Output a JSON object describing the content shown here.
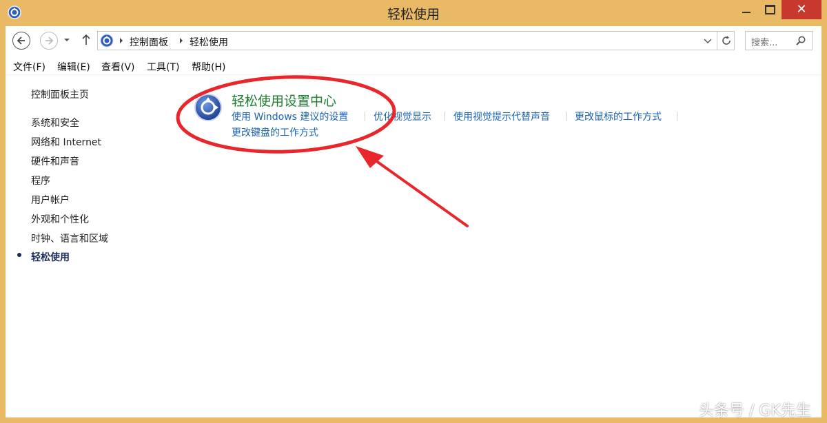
{
  "window": {
    "title": "轻松使用"
  },
  "address": {
    "crumbs": [
      "控制面板",
      "轻松使用"
    ]
  },
  "search": {
    "placeholder": "搜索..."
  },
  "menu": [
    "文件(F)",
    "编辑(E)",
    "查看(V)",
    "工具(T)",
    "帮助(H)"
  ],
  "sidebar": {
    "home": "控制面板主页",
    "items": [
      "系统和安全",
      "网络和 Internet",
      "硬件和声音",
      "程序",
      "用户帐户",
      "外观和个性化",
      "时钟、语言和区域",
      "轻松使用"
    ],
    "current_index": 7
  },
  "content": {
    "category_title": "轻松使用设置中心",
    "links": [
      "使用 Windows 建议的设置",
      "优化视觉显示",
      "使用视觉提示代替声音",
      "更改鼠标的工作方式",
      "更改键盘的工作方式"
    ]
  },
  "annotation": {
    "ellipse_color": "#e8262b",
    "arrow_color": "#e8262b"
  },
  "colors": {
    "title_bar": "#e9b966",
    "close_button": "#c7392d",
    "category_green": "#1e7f2f",
    "link_blue": "#1a63b3"
  },
  "watermark": "头条号 / GK先生"
}
